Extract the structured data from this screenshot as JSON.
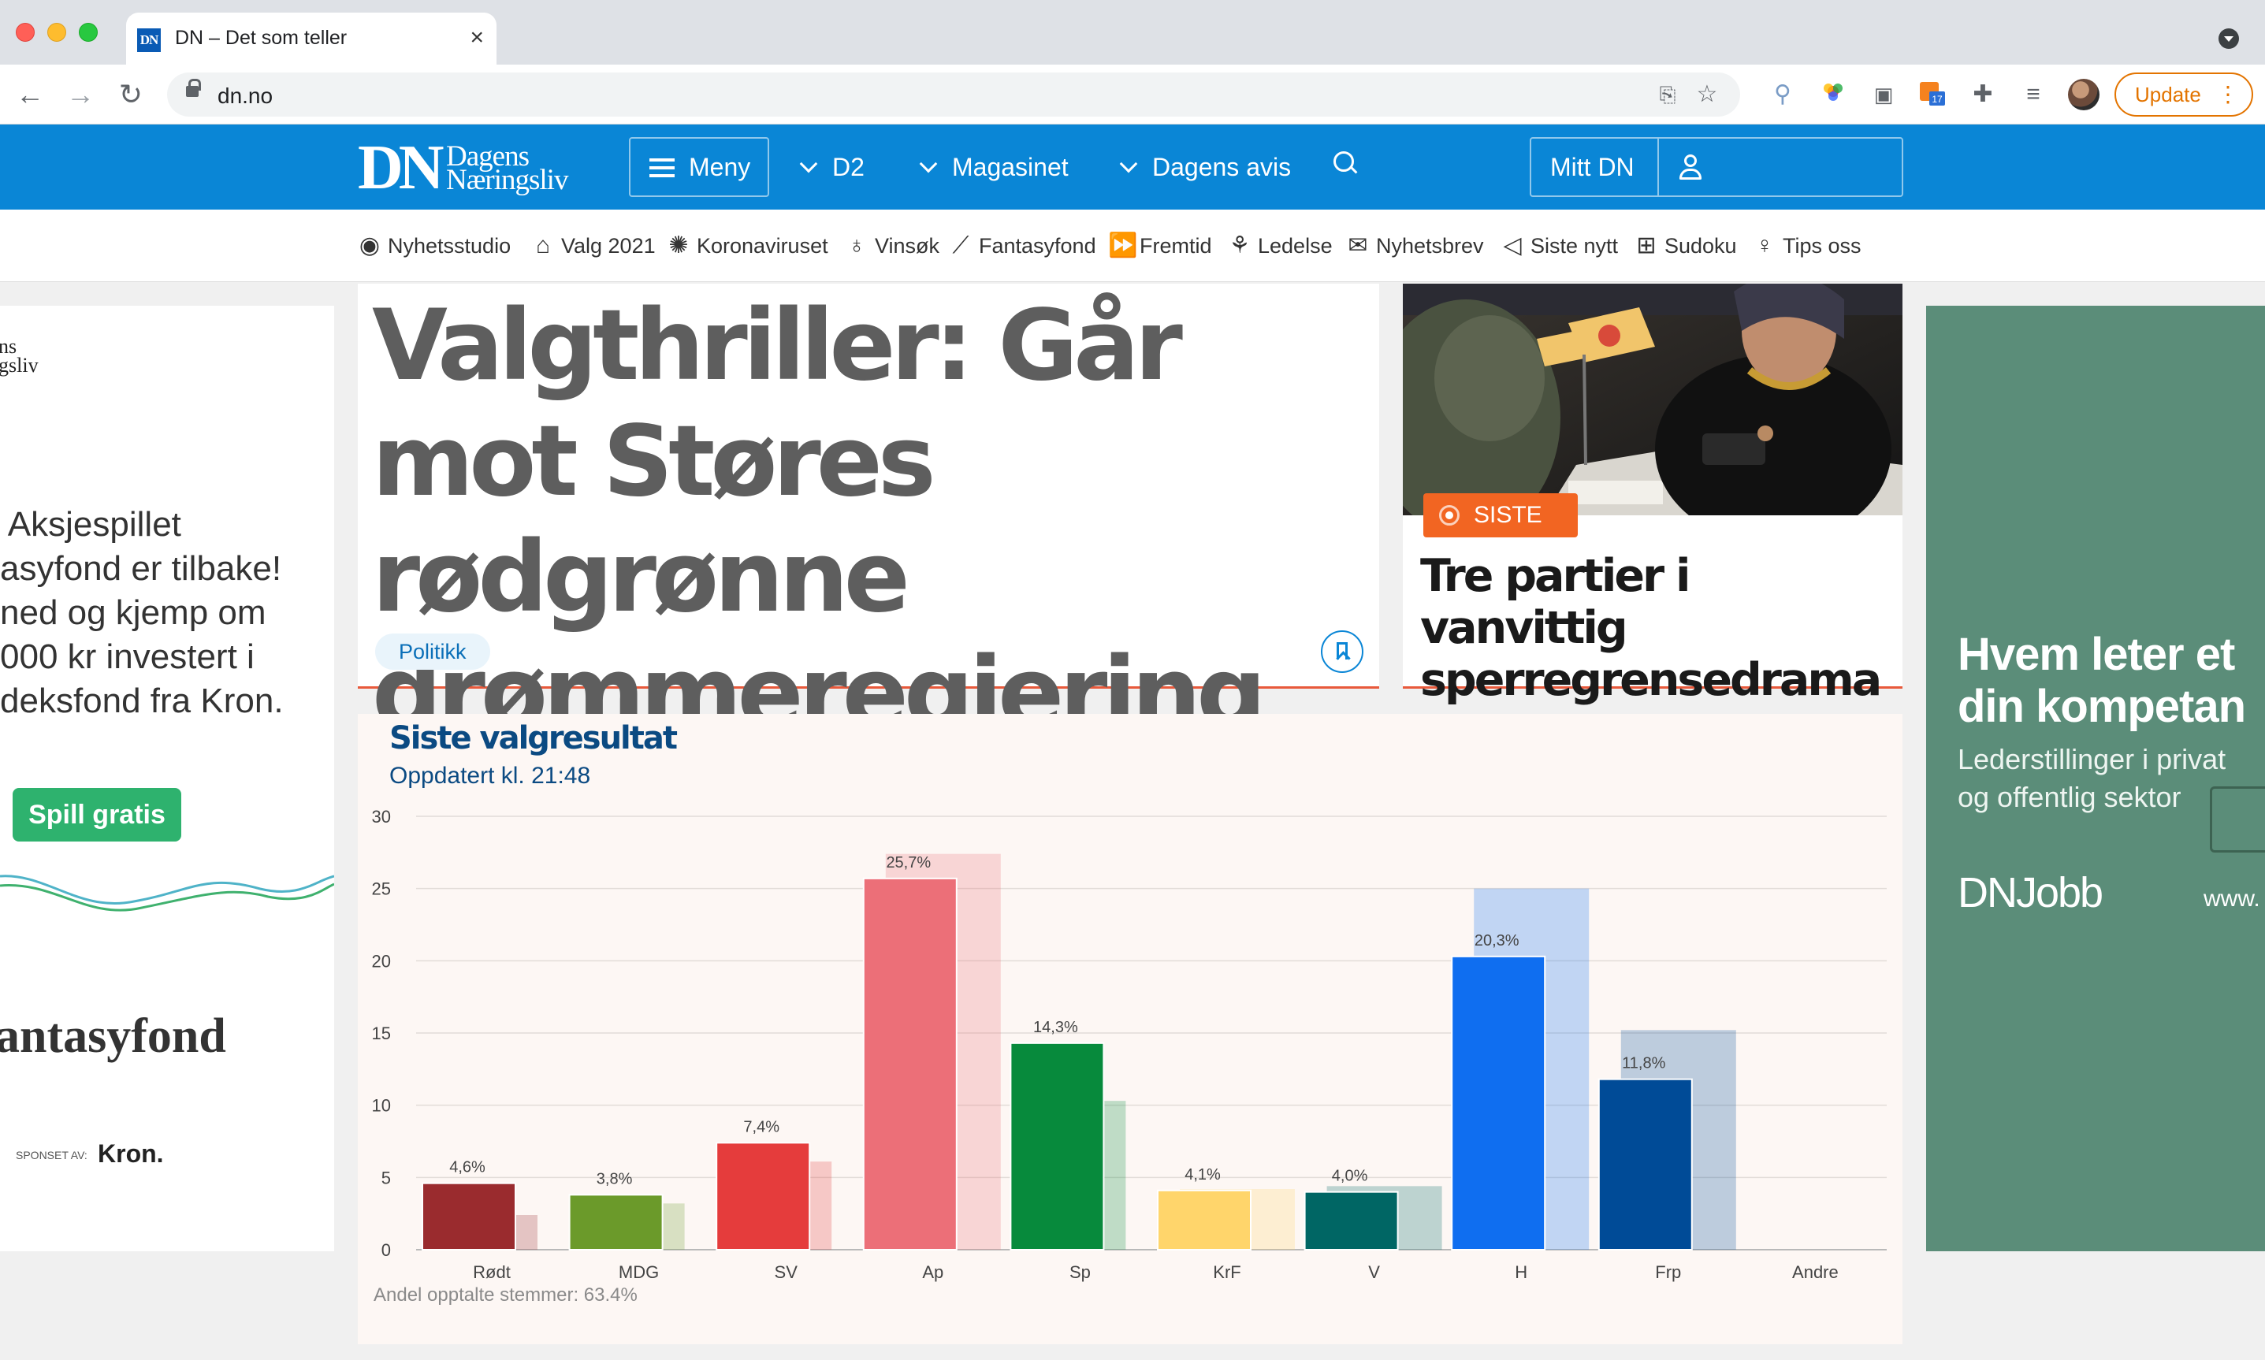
{
  "browser": {
    "tab_title": "DN – Det som teller",
    "tab_favicon": "DN",
    "url": "dn.no",
    "update_label": "Update"
  },
  "header": {
    "logo_letters": "DN",
    "logo_name_line1": "Dagens",
    "logo_name_line2": "Næringsliv",
    "menu_label": "Meny",
    "links": [
      "D2",
      "Magasinet",
      "Dagens avis"
    ],
    "account_label": "Mitt DN"
  },
  "subnav": [
    {
      "label": "Nyhetsstudio",
      "icon": "record-icon"
    },
    {
      "label": "Valg 2021",
      "icon": "ballot-box-icon"
    },
    {
      "label": "Koronaviruset",
      "icon": "virus-icon"
    },
    {
      "label": "Vinsøk",
      "icon": "wine-glass-icon"
    },
    {
      "label": "Fantasyfond",
      "icon": "chart-line-icon"
    },
    {
      "label": "Fremtid",
      "icon": "fast-forward-icon"
    },
    {
      "label": "Ledelse",
      "icon": "org-chart-icon"
    },
    {
      "label": "Nyhetsbrev",
      "icon": "envelope-icon"
    },
    {
      "label": "Siste nytt",
      "icon": "megaphone-icon"
    },
    {
      "label": "Sudoku",
      "icon": "grid-icon"
    },
    {
      "label": "Tips oss",
      "icon": "lightbulb-icon"
    }
  ],
  "main_story": {
    "headline": "Valgthriller: Går mot Støres rødgrønne drømmeregjering",
    "tag": "Politikk"
  },
  "side_story": {
    "badge": "SISTE",
    "headline": "Tre partier i vanvittig sperregrensedrama"
  },
  "ad_left": {
    "logo_fragment": "ns\ngsliv",
    "text": " Aksjespillet\nasyfond er tilbake!\nned og kjemp om\n000 kr investert i\ndeksfond fra Kron.",
    "button": "Spill gratis",
    "brand": "antasyfond",
    "sponsor_label": "SPONSET AV:",
    "sponsor": "Kron."
  },
  "ad_right": {
    "headline": "Hvem leter et\ndin kompetan",
    "sub": "Lederstillinger i privat\nog offentlig sektor",
    "brand": "DNJobb",
    "url_fragment": "www."
  },
  "chart": {
    "title": "Siste valgresultat",
    "subtitle": "Oppdatert kl. 21:48",
    "footnote": "Andel opptalte stemmer: 63.4%"
  },
  "chart_data": {
    "type": "bar",
    "categories": [
      "Rødt",
      "MDG",
      "SV",
      "Ap",
      "Sp",
      "KrF",
      "V",
      "H",
      "Frp",
      "Andre"
    ],
    "series": [
      {
        "values": [
          4.6,
          3.8,
          7.4,
          25.7,
          14.3,
          4.1,
          4.0,
          20.3,
          11.8,
          null
        ],
        "labels": [
          "4,6%",
          "3,8%",
          "7,4%",
          "25,7%",
          "14,3%",
          "4,1%",
          "4,0%",
          "20,3%",
          "11,8%",
          ""
        ]
      },
      {
        "values": [
          2.4,
          3.2,
          6.1,
          27.4,
          10.3,
          4.2,
          4.4,
          25.0,
          15.2,
          null
        ]
      }
    ],
    "colors": [
      "#9a2b2e",
      "#6b9a2a",
      "#e53c3c",
      "#ec6f78",
      "#078a3c",
      "#ffd56b",
      "#006664",
      "#0f6ef0",
      "#004b97",
      "#888888"
    ],
    "ylim": [
      0,
      30
    ],
    "yticks": [
      0,
      5,
      10,
      15,
      20,
      25,
      30
    ],
    "grid": true
  }
}
